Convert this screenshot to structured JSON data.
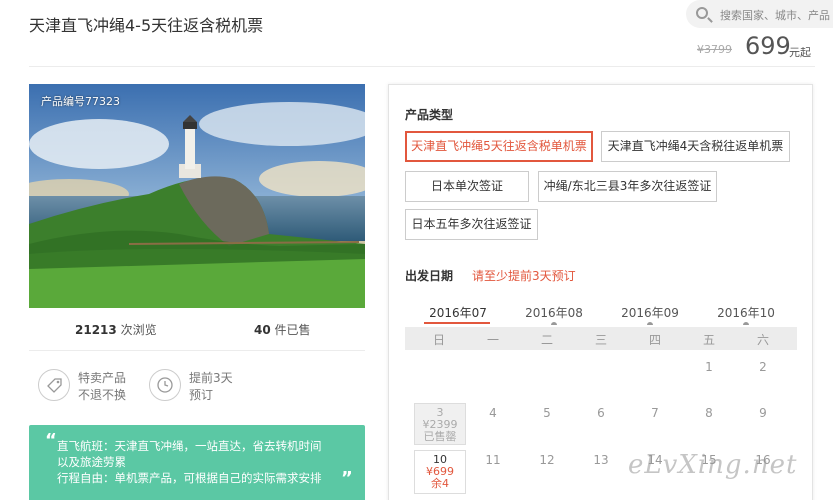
{
  "header": {
    "title": "天津直飞冲绳4-5天往返含税机票",
    "search_placeholder": "搜索国家、城市、产品",
    "price_old": "¥3799",
    "price_now": "699",
    "price_unit": "元起"
  },
  "product": {
    "photo_label": "产品编号77323",
    "views_count": "21213",
    "views_label": "次浏览",
    "sold_count": "40",
    "sold_label": "件已售"
  },
  "features": [
    {
      "line1": "特卖产品",
      "line2": "不退不换",
      "icon": "tag-icon"
    },
    {
      "line1": "提前3天",
      "line2": "预订",
      "icon": "clock-icon"
    }
  ],
  "highlight": {
    "lines": [
      "直飞航班：天津直飞冲绳，一站直达，省去转机时间",
      "以及旅途劳累",
      "行程自由：单机票产品，可根据自己的实际需求安排"
    ]
  },
  "panel": {
    "type_title": "产品类型",
    "options": [
      "天津直飞冲绳5天往返含税单机票",
      "天津直飞冲绳4天含税往返单机票",
      "日本单次签证",
      "冲绳/东北三县3年多次往返签证",
      "日本五年多次往返签证"
    ],
    "date_title": "出发日期",
    "date_hint": "请至少提前3天预订",
    "months": [
      "2016年07",
      "2016年08",
      "2016年09",
      "2016年10"
    ],
    "weekdays": [
      "日",
      "一",
      "二",
      "三",
      "四",
      "五",
      "六"
    ],
    "row1": [
      "1",
      "2"
    ],
    "row2": [
      "4",
      "5",
      "6",
      "7",
      "8",
      "9"
    ],
    "row3": [
      "11",
      "12",
      "13",
      "14",
      "15",
      "16"
    ],
    "cell_past": {
      "day": "3",
      "price": "¥2399",
      "status": "已售罄"
    },
    "cell_avail": {
      "day": "10",
      "price": "¥699",
      "status": "余4"
    }
  },
  "watermark": "eLvXing.net",
  "colors": {
    "accent": "#e2573d",
    "green": "#5bc8a4"
  }
}
